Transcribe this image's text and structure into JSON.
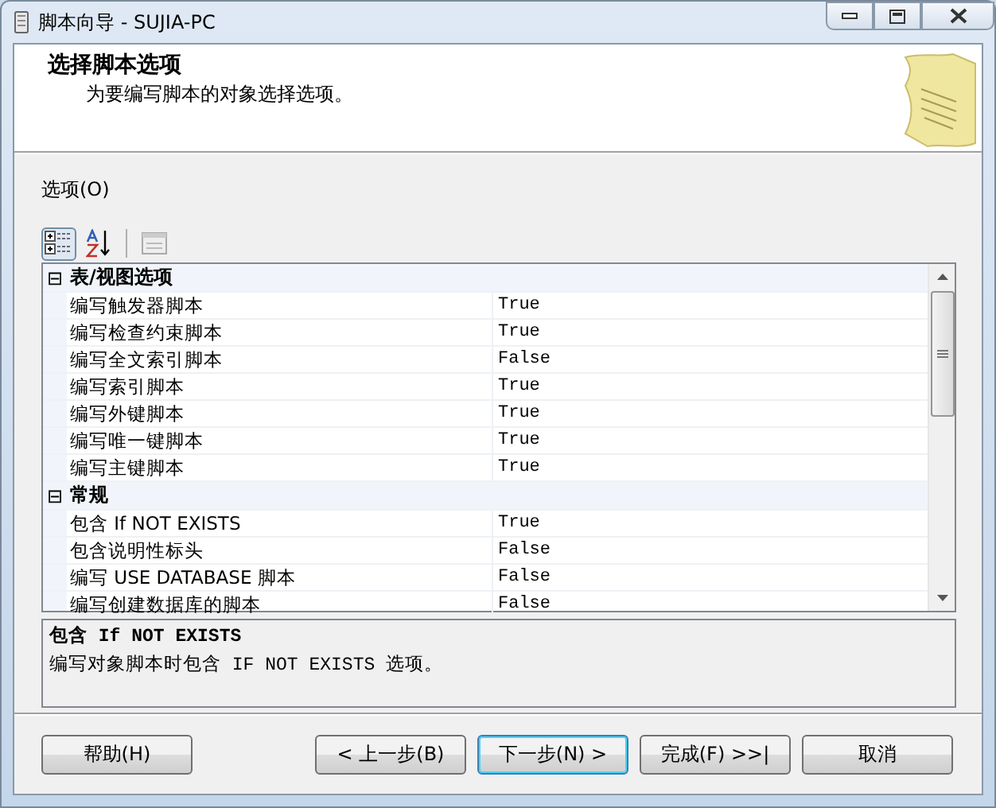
{
  "window": {
    "title": "脚本向导 - SUJIA-PC"
  },
  "header": {
    "title": "选择脚本选项",
    "subtitle": "为要编写脚本的对象选择选项。"
  },
  "options_label": "选项(O)",
  "toolbar": [
    {
      "kind": "categorized",
      "selected": true
    },
    {
      "kind": "alphabetical",
      "selected": false
    },
    {
      "kind": "pages",
      "selected": false
    }
  ],
  "grid": {
    "categories": [
      {
        "name": "表/视图选项",
        "expander": "⊟",
        "rows": [
          {
            "name": "编写触发器脚本",
            "value": "True"
          },
          {
            "name": "编写检查约束脚本",
            "value": "True"
          },
          {
            "name": "编写全文索引脚本",
            "value": "False"
          },
          {
            "name": "编写索引脚本",
            "value": "True"
          },
          {
            "name": "编写外键脚本",
            "value": "True"
          },
          {
            "name": "编写唯一键脚本",
            "value": "True"
          },
          {
            "name": "编写主键脚本",
            "value": "True"
          }
        ]
      },
      {
        "name": "常规",
        "expander": "⊟",
        "rows": [
          {
            "name": "包含 If NOT EXISTS",
            "value": "True"
          },
          {
            "name": "包含说明性标头",
            "value": "False"
          },
          {
            "name": "编写 USE DATABASE 脚本",
            "value": "False"
          },
          {
            "name": "编写创建数据库的脚本",
            "value": "False"
          }
        ]
      }
    ]
  },
  "description": {
    "title": "包含 If NOT EXISTS",
    "text": "编写对象脚本时包含 IF NOT EXISTS 选项。"
  },
  "buttons": [
    {
      "label": "帮助(H)",
      "default": false
    },
    {
      "label": "< 上一步(B)",
      "default": false
    },
    {
      "label": "下一步(N) >",
      "default": true
    },
    {
      "label": "完成(F) >>|",
      "default": false
    },
    {
      "label": "取消",
      "default": false
    }
  ]
}
